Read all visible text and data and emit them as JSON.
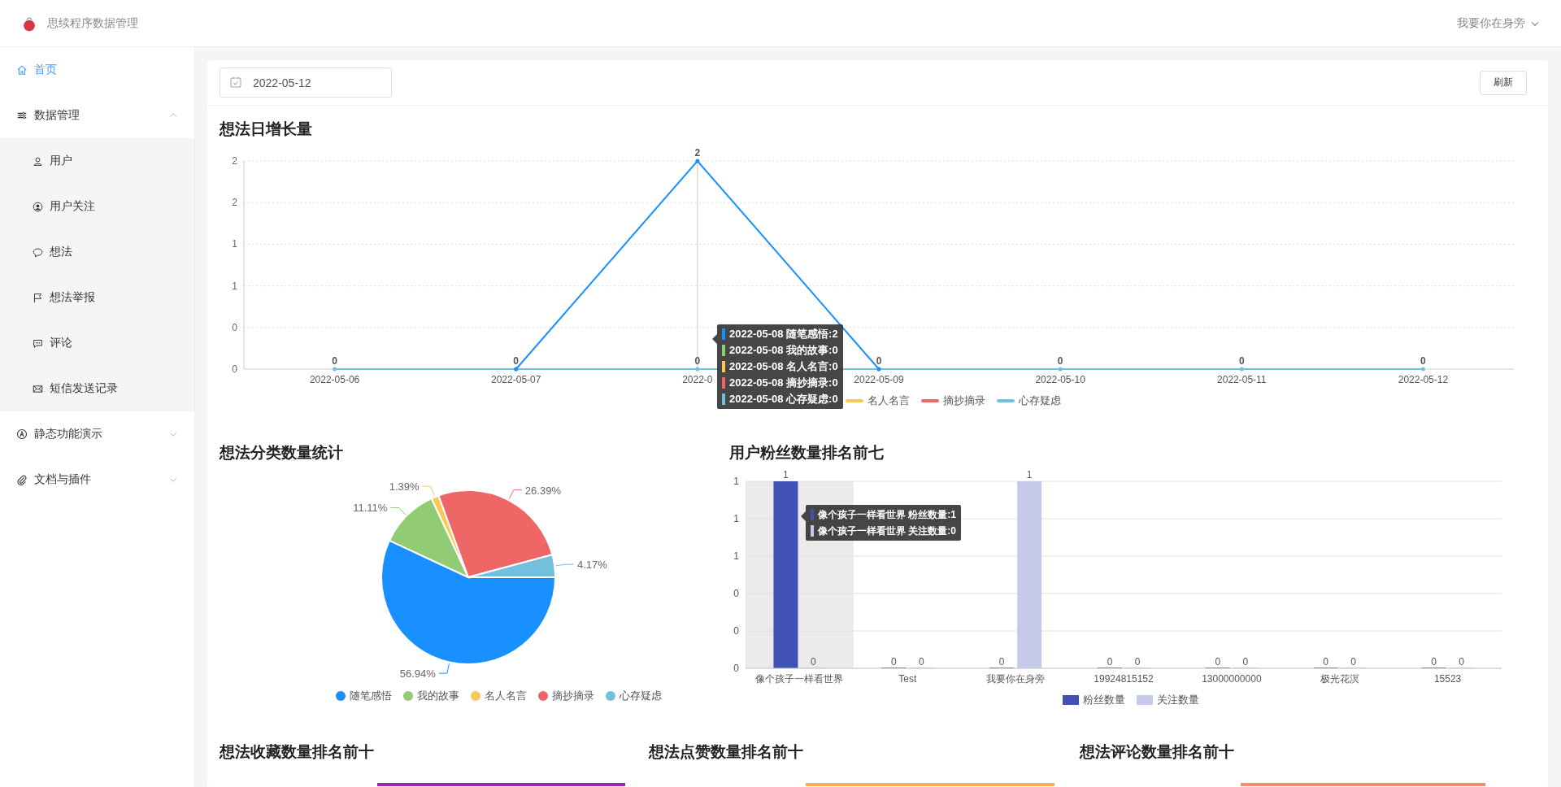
{
  "header": {
    "app_title": "思续程序数据管理",
    "user_name": "我要你在身旁"
  },
  "sidebar": {
    "items": [
      {
        "label": "首页",
        "selected": true
      },
      {
        "label": "数据管理",
        "selected": false,
        "expanded": true,
        "children": [
          {
            "label": "用户",
            "selected": false
          },
          {
            "label": "用户关注",
            "selected": false
          },
          {
            "label": "想法",
            "selected": false
          },
          {
            "label": "想法举报",
            "selected": false
          },
          {
            "label": "评论",
            "selected": false
          },
          {
            "label": "短信发送记录",
            "selected": false
          }
        ]
      },
      {
        "label": "静态功能演示",
        "selected": false,
        "expanded": false
      },
      {
        "label": "文档与插件",
        "selected": false,
        "expanded": false
      }
    ]
  },
  "toolbar": {
    "date": "2022-05-12",
    "refresh_button": "刷新"
  },
  "daily_growth": {
    "title": "想法日增长量",
    "chart_data": {
      "type": "line",
      "categories": [
        "2022-05-06",
        "2022-05-07",
        "2022-0",
        "2022-05-09",
        "2022-05-10",
        "2022-05-11",
        "2022-05-12"
      ],
      "series": [
        {
          "name": "心存疑虑",
          "color": "#73c0de",
          "values": [
            0,
            0,
            0,
            0,
            0,
            0,
            0
          ],
          "value_labels": [
            "0",
            "0",
            "0",
            "0",
            "0",
            "0",
            "0"
          ]
        },
        {
          "color": "#1890ff",
          "values": [
            null,
            0,
            2,
            0,
            null,
            null,
            null
          ],
          "value_labels": [
            null,
            null,
            "2",
            null,
            null,
            null,
            null
          ]
        }
      ],
      "ylim": [
        0,
        2
      ],
      "yticks": [
        {
          "value": 0,
          "label": "0"
        },
        {
          "value": 0.4,
          "label": "0"
        },
        {
          "value": 0.8,
          "label": "1"
        },
        {
          "value": 1.2,
          "label": "1"
        },
        {
          "value": 1.6,
          "label": "2"
        },
        {
          "value": 2,
          "label": "2"
        }
      ],
      "grid": true,
      "ref_lines": [
        {
          "axis": "x",
          "value": "2022-0"
        }
      ]
    },
    "legend": [
      {
        "label": "名人名言",
        "color": "#fac858"
      },
      {
        "label": "摘抄摘录",
        "color": "#ee6666"
      }
    ],
    "tooltip": [
      {
        "text": "2022-05-08 随笔感悟:2",
        "color": "#1890ff"
      },
      {
        "text": "2022-05-08 我的故事:0",
        "color": "#91cc75"
      },
      {
        "text": "2022-05-08 名人名言:0",
        "color": "#fac858"
      },
      {
        "text": "2022-05-08 摘抄摘录:0",
        "color": "#ee6666"
      },
      {
        "text": "2022-05-08 心存疑虑:0",
        "color": "#73c0de"
      }
    ]
  },
  "category_stats": {
    "title": "想法分类数量统计",
    "chart_data": {
      "type": "pie",
      "categories": [
        "随笔感悟",
        "我的故事",
        "名人名言",
        "摘抄摘录",
        "心存疑虑"
      ],
      "values": [
        56.94,
        11.11,
        1.39,
        26.39,
        4.17
      ],
      "colors": [
        "#1890ff",
        "#91cc75",
        "#fac858",
        "#ee6666",
        "#73c0de"
      ],
      "value_labels": [
        "56.94%",
        "11.11%",
        "1.39%",
        "26.39%",
        "4.17%"
      ]
    }
  },
  "fans_ranking": {
    "title": "用户粉丝数量排名前七",
    "chart_data": {
      "type": "bar",
      "categories": [
        "像个孩子一样看世界",
        "Test",
        "我要你在身旁",
        "19924815152",
        "13000000000",
        "极光花溟",
        "15523"
      ],
      "series": [
        {
          "name": "粉丝数量",
          "color": "#3f51b5",
          "values": [
            1,
            0,
            0,
            0,
            0,
            0,
            0
          ]
        },
        {
          "name": "关注数量",
          "color": "#c5cae9",
          "values": [
            0,
            0,
            1,
            0,
            0,
            0,
            0
          ]
        }
      ],
      "ylim": [
        0,
        1
      ],
      "yticks": [
        {
          "value": 0,
          "label": "0"
        },
        {
          "value": 0.2,
          "label": "0"
        },
        {
          "value": 0.4,
          "label": "0"
        },
        {
          "value": 0.6,
          "label": "1"
        },
        {
          "value": 0.8,
          "label": "1"
        },
        {
          "value": 1,
          "label": "1"
        }
      ],
      "grid": true,
      "data_labels": true,
      "bands": [
        {
          "axis": "x",
          "from": "像个孩子一样看世界",
          "to": "像个孩子一样看世界"
        }
      ]
    },
    "tooltip": [
      {
        "text": "像个孩子一样看世界 粉丝数量:1",
        "color": "#3f51b5"
      },
      {
        "text": "像个孩子一样看世界 关注数量:0",
        "color": "#c5cae9"
      }
    ]
  },
  "bottom_panels": [
    {
      "title": "想法收藏数量排名前十",
      "color": "#9c27b0"
    },
    {
      "title": "想法点赞数量排名前十",
      "color": "#f6b04f"
    },
    {
      "title": "想法评论数量排名前十",
      "color": "#f88a6a"
    }
  ]
}
